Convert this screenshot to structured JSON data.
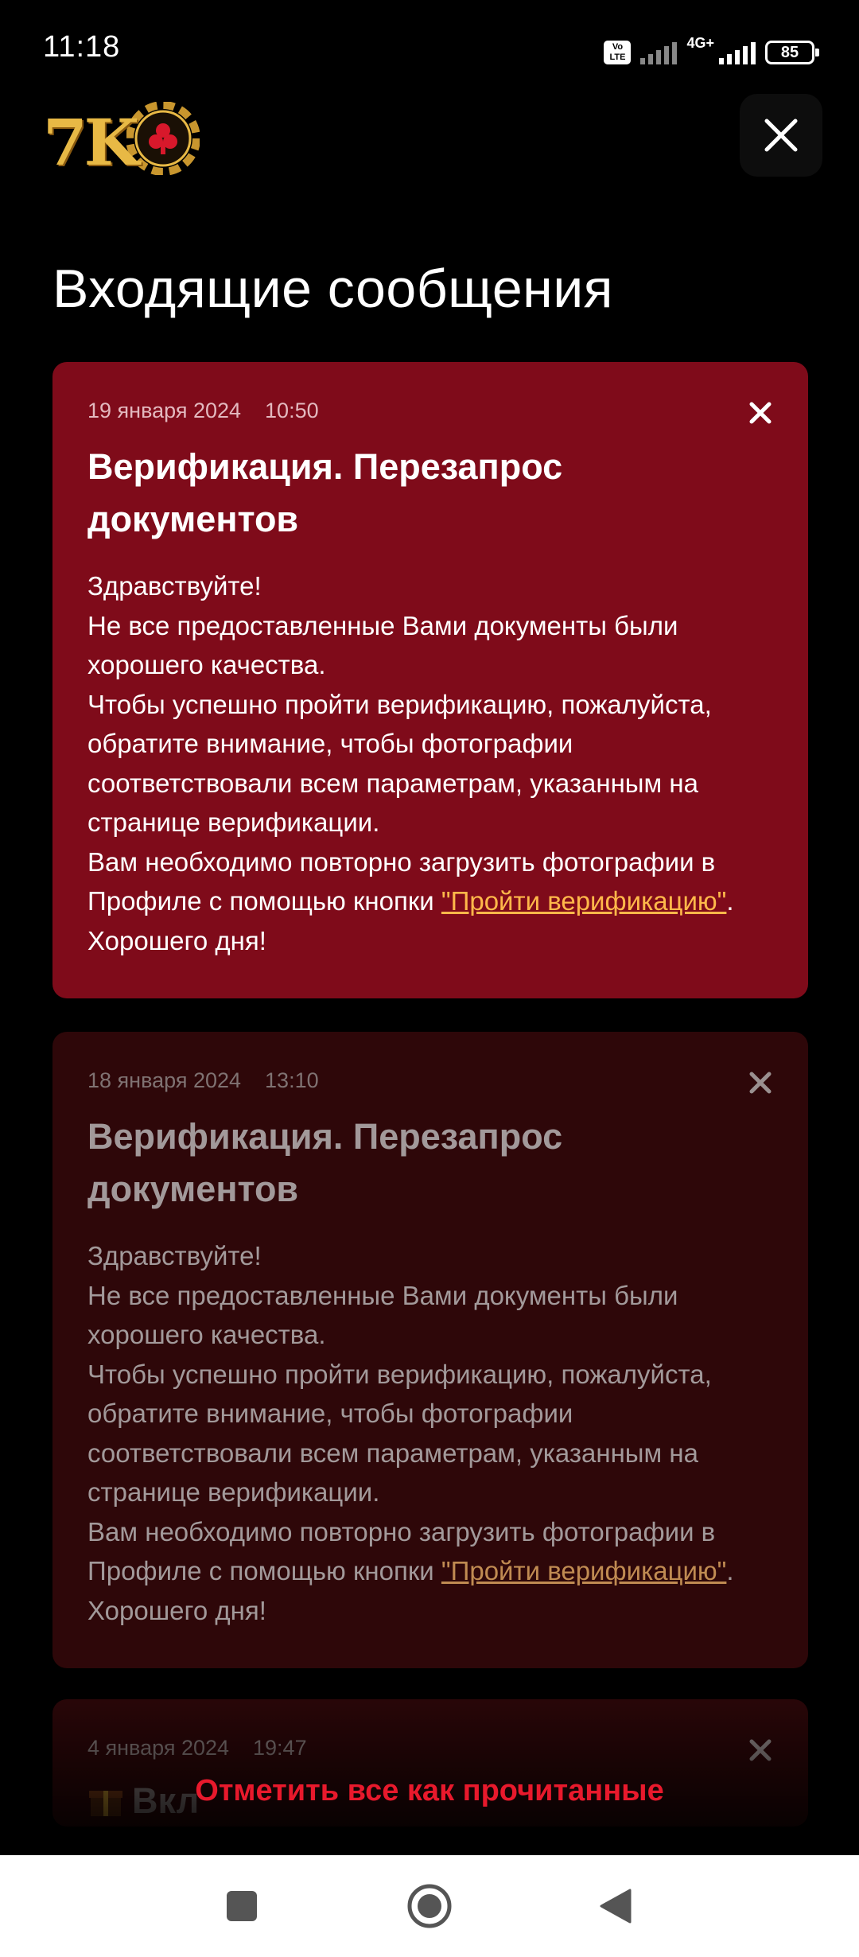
{
  "status_bar": {
    "time": "11:18",
    "volte_label": "Vo LTE",
    "network_type": "4G+",
    "battery_level": "85"
  },
  "header": {
    "logo_text": "7K"
  },
  "page": {
    "title": "Входящие сообщения"
  },
  "messages": [
    {
      "date": "19 января 2024",
      "time": "10:50",
      "title": "Верификация. Перезапрос документов",
      "body_before_link": "Здравствуйте!\nНе все предоставленные Вами документы были хорошего качества.\nЧтобы успешно пройти верификацию, пожалуйста, обратите внимание, чтобы фотографии соответствовали всем параметрам, указанным на странице верификации.\nВам необходимо повторно загрузить фотографии в Профиле с помощью кнопки ",
      "link_text": "\"Пройти верификацию\"",
      "body_after_link": ".\nХорошего дня!",
      "status": "unread"
    },
    {
      "date": "18 января 2024",
      "time": "13:10",
      "title": "Верификация. Перезапрос документов",
      "body_before_link": "Здравствуйте!\nНе все предоставленные Вами документы были хорошего качества.\nЧтобы успешно пройти верификацию, пожалуйста, обратите внимание, чтобы фотографии соответствовали всем параметрам, указанным на странице верификации.\nВам необходимо повторно загрузить фотографии в Профиле с помощью кнопки ",
      "link_text": "\"Пройти верификацию\"",
      "body_after_link": ".\nХорошего дня!",
      "status": "read"
    },
    {
      "date": "4 января 2024",
      "time": "19:47",
      "title_partial": "Вкл",
      "status": "read"
    }
  ],
  "footer": {
    "mark_all_label": "Отметить все как прочитанные"
  },
  "colors": {
    "unread_card": "#7f0b1a",
    "read_card": "#2e0709",
    "accent_red": "#e8192c",
    "link": "#ffb84a",
    "logo_gold": "#e8b945"
  },
  "icons": [
    "close-icon",
    "gift-icon",
    "square-nav-icon",
    "circle-nav-icon",
    "back-triangle-icon"
  ]
}
